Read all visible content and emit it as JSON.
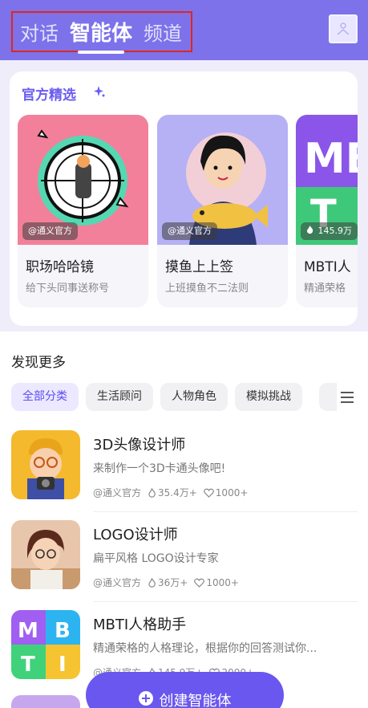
{
  "header": {
    "tabs": [
      {
        "label": "对话",
        "active": false
      },
      {
        "label": "智能体",
        "active": true
      },
      {
        "label": "频道",
        "active": false
      }
    ],
    "accent_color": "#7d72ea"
  },
  "featured": {
    "title": "官方精选",
    "cards": [
      {
        "name": "职场哈哈镜",
        "desc": "给下头同事送称号",
        "tag": "@通义官方"
      },
      {
        "name": "摸鱼上上签",
        "desc": "上班摸鱼不二法则",
        "tag": "@通义官方"
      },
      {
        "name": "MBTI人",
        "desc": "精通荣格",
        "tag": "145.9万"
      }
    ]
  },
  "discover": {
    "title": "发现更多",
    "chips": [
      "全部分类",
      "生活顾问",
      "人物角色",
      "模拟挑战"
    ],
    "items": [
      {
        "name": "3D头像设计师",
        "desc": "来制作一个3D卡通头像吧!",
        "author": "@通义官方",
        "hot": "35.4万+",
        "likes": "1000+"
      },
      {
        "name": "LOGO设计师",
        "desc": "扁平风格 LOGO设计专家",
        "author": "@通义官方",
        "hot": "36万+",
        "likes": "1000+"
      },
      {
        "name": "MBTI人格助手",
        "desc": "精通荣格的人格理论，根据你的回答测试你...",
        "author": "@通义官方",
        "hot": "145.9万+",
        "likes": "2000+"
      }
    ]
  },
  "create_button": {
    "label": "创建智能体"
  }
}
